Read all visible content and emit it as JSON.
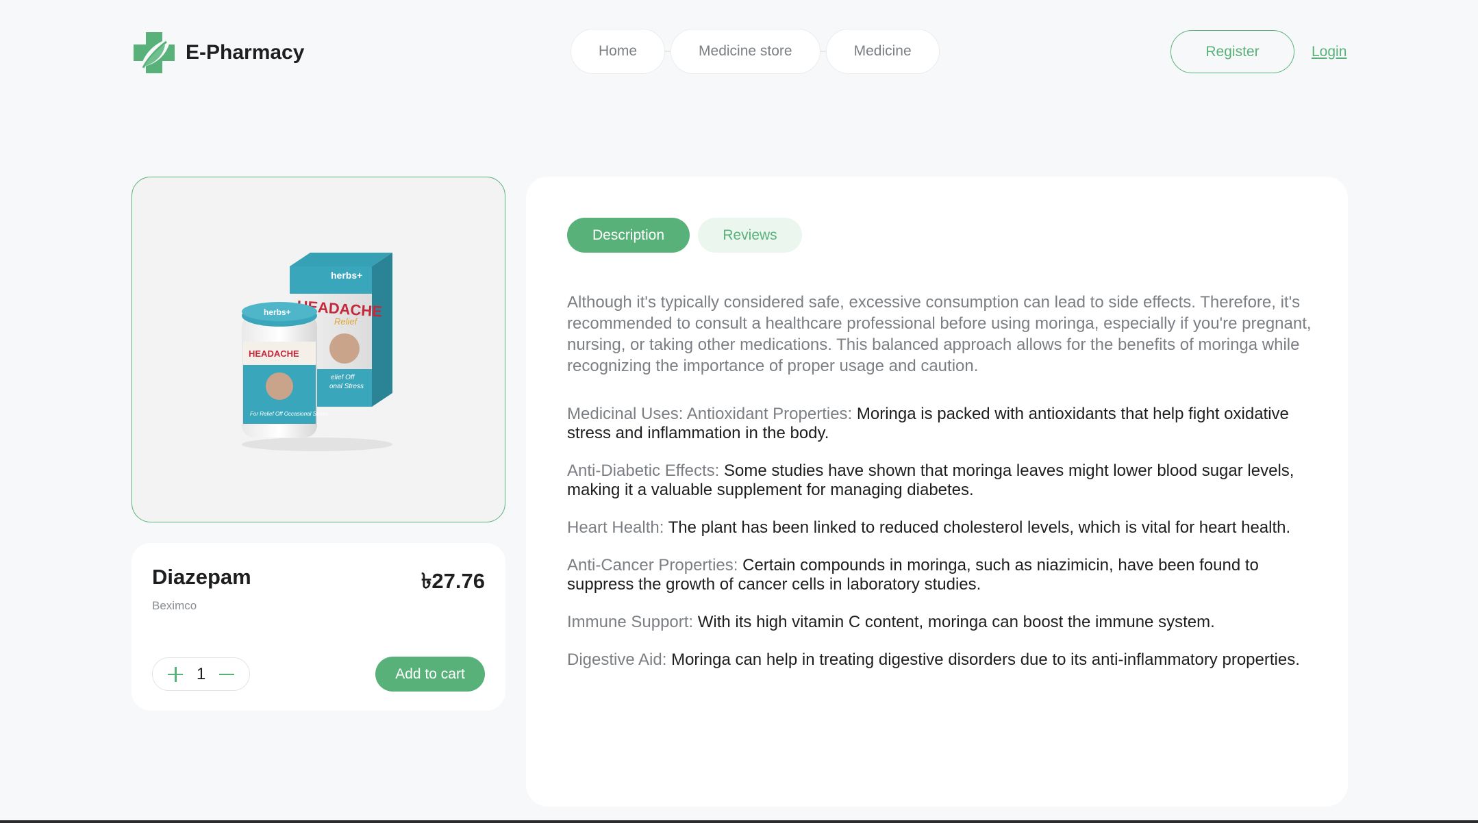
{
  "brand": {
    "name": "E-Pharmacy",
    "logo_icon": "leaf-cross-logo-icon",
    "accent_color": "#59b17a"
  },
  "nav": {
    "items": [
      "Home",
      "Medicine store",
      "Medicine"
    ]
  },
  "auth": {
    "register": "Register",
    "login": "Login"
  },
  "product": {
    "name": "Diazepam",
    "price": "৳27.76",
    "brand": "Beximco",
    "quantity": "1",
    "add_to_cart": "Add to cart",
    "image_box_texts": [
      "herbs+",
      "HEADACHE",
      "Relief",
      "For Relief Off Occasional Stress",
      "elief Off",
      "onal Stress"
    ]
  },
  "tabs": {
    "description": "Description",
    "reviews": "Reviews"
  },
  "description": {
    "intro": "Although it's typically considered safe, excessive consumption can lead to side effects. Therefore, it's recommended to consult a healthcare professional before using moringa, especially if you're pregnant, nursing, or taking other medications. This balanced approach allows for the benefits of moringa while recognizing the importance of proper usage and caution.",
    "items": [
      {
        "label": "Medicinal Uses: Antioxidant Properties:",
        "text": "Moringa is packed with antioxidants that help fight oxidative stress and inflammation in the body."
      },
      {
        "label": "Anti-Diabetic Effects:",
        "text": "Some studies have shown that moringa leaves might lower blood sugar levels, making it a valuable supplement for managing diabetes."
      },
      {
        "label": "Heart Health:",
        "text": "The plant has been linked to reduced cholesterol levels, which is vital for heart health."
      },
      {
        "label": "Anti-Cancer Properties:",
        "text": "Certain compounds in moringa, such as niazimicin, have been found to suppress the growth of cancer cells in laboratory studies."
      },
      {
        "label": "Immune Support:",
        "text": "With its high vitamin C content, moringa can boost the immune system."
      },
      {
        "label": "Digestive Aid:",
        "text": "Moringa can help in treating digestive disorders due to its anti-inflammatory properties."
      }
    ]
  }
}
